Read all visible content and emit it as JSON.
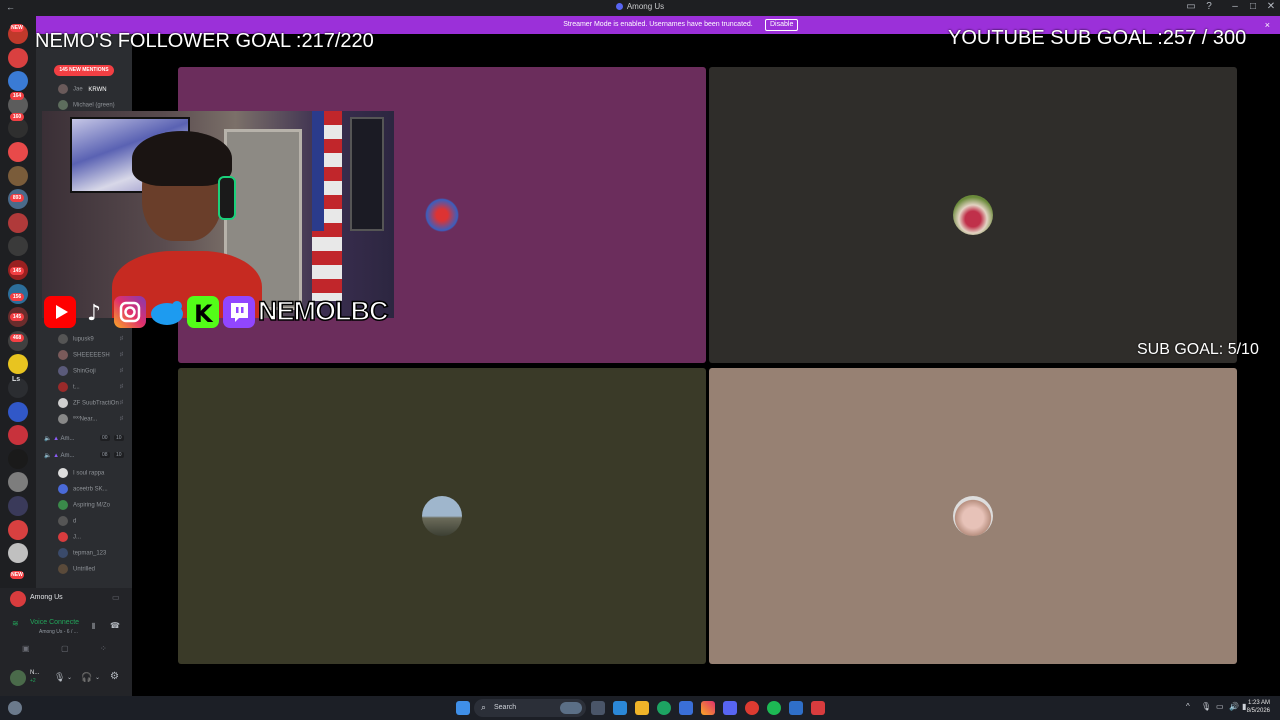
{
  "window": {
    "title": "Among Us"
  },
  "streamer_bar": {
    "message": "Streamer Mode is enabled. Usernames have been truncated.",
    "disable_label": "Disable",
    "close_label": "×"
  },
  "overlays": {
    "follower_goal": "NEMO'S FOLLOWER GOAL :217/220",
    "youtube_goal": "YOUTUBE SUB GOAL :257 / 300",
    "sub_goal": "SUB GOAL: 5/10",
    "brand": "NEMOLBC"
  },
  "guild_rail": {
    "badges": [
      "NEW",
      "164",
      "160",
      "893",
      "145",
      "156",
      "145",
      "468",
      "NEW"
    ],
    "text_icon": "Ls",
    "colors": [
      "#c0392b",
      "#d94040",
      "#3a7bd5",
      "#5c5c5c",
      "#2f2f2f",
      "#e84a4a",
      "#7a5c3a",
      "#4a6a8a",
      "#b03a3a",
      "#3a3a3a",
      "#9a2020",
      "#2c6e9a",
      "#6a2c2c",
      "#404040",
      "#e8c420",
      "#2b2d31",
      "#3158c8",
      "#c8323c",
      "#1a1a1a",
      "#7d7d7d",
      "#3a3a5a",
      "#d84040",
      "#c0c0c0"
    ]
  },
  "channels": {
    "mentions_label": "145 NEW MENTIONS",
    "voice_users_top": [
      {
        "name": "Jae",
        "tag": "KRWN"
      },
      {
        "name": "Michael (green)"
      }
    ],
    "voice_users_mid": [
      {
        "name": "lupusk9"
      },
      {
        "name": "SHEEEEESH"
      },
      {
        "name": "ShinGoji"
      },
      {
        "name": "t..."
      },
      {
        "name": "ZF SuubTractiOn"
      },
      {
        "name": "ºººNear..."
      }
    ],
    "voice_channels": [
      {
        "name": "Am...",
        "count": "00",
        "limit": "10"
      },
      {
        "name": "Am...",
        "count": "08",
        "limit": "10"
      }
    ],
    "voice_users_bottom": [
      {
        "name": "I soul rappa"
      },
      {
        "name": "aceetrb SK..."
      },
      {
        "name": "Aspiring M/Zo"
      },
      {
        "name": "d"
      },
      {
        "name": "J..."
      },
      {
        "name": "tepman_123"
      },
      {
        "name": "Untrilled"
      }
    ]
  },
  "voice_status": {
    "server_name": "Among Us",
    "status": "Voice Connecte",
    "channel": "Among Us - 6 / ...",
    "user_name": "N...",
    "user_sub": "+2"
  },
  "grid": {
    "tiles": [
      {
        "bg": "#6b2d5c"
      },
      {
        "bg": "#2f2d2a"
      },
      {
        "bg": "#3a3a28"
      },
      {
        "bg": "#978173"
      }
    ]
  },
  "taskbar": {
    "search_label": "Search",
    "time": "1:23 AM",
    "date": "8/5/2026"
  }
}
